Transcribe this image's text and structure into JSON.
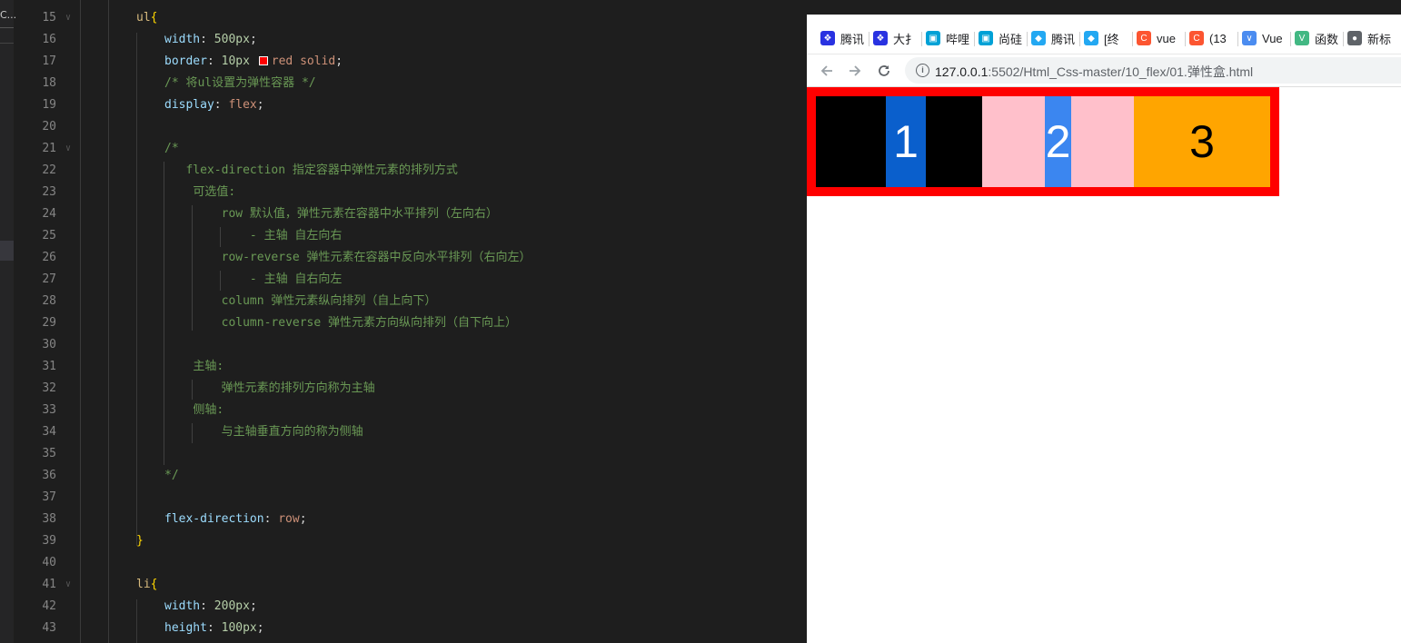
{
  "editor": {
    "left_strip_label": "C...",
    "lines": [
      {
        "n": "15",
        "fold": true,
        "indent": 1,
        "tokens": [
          {
            "c": "t-sel",
            "t": "ul"
          },
          {
            "c": "t-brace",
            "t": "{"
          }
        ]
      },
      {
        "n": "16",
        "indent": 2,
        "tokens": [
          {
            "c": "t-prop",
            "t": "width"
          },
          {
            "c": "t-punc",
            "t": ": "
          },
          {
            "c": "t-num",
            "t": "500px"
          },
          {
            "c": "t-punc",
            "t": ";"
          }
        ]
      },
      {
        "n": "17",
        "indent": 2,
        "tokens": [
          {
            "c": "t-prop",
            "t": "border"
          },
          {
            "c": "t-punc",
            "t": ": "
          },
          {
            "c": "t-num",
            "t": "10px "
          },
          {
            "c": "t-swatch",
            "t": ""
          },
          {
            "c": "t-val",
            "t": "red solid"
          },
          {
            "c": "t-punc",
            "t": ";"
          }
        ]
      },
      {
        "n": "18",
        "indent": 2,
        "tokens": [
          {
            "c": "t-com",
            "t": "/* 将ul设置为弹性容器 */"
          }
        ]
      },
      {
        "n": "19",
        "indent": 2,
        "tokens": [
          {
            "c": "t-prop",
            "t": "display"
          },
          {
            "c": "t-punc",
            "t": ": "
          },
          {
            "c": "t-val",
            "t": "flex"
          },
          {
            "c": "t-punc",
            "t": ";"
          }
        ]
      },
      {
        "n": "20",
        "indent": 0,
        "tokens": []
      },
      {
        "n": "21",
        "fold": true,
        "indent": 2,
        "tokens": [
          {
            "c": "t-com",
            "t": "/*"
          }
        ]
      },
      {
        "n": "22",
        "indent": 2,
        "pad": "   ",
        "tokens": [
          {
            "c": "t-com",
            "t": "flex-direction 指定容器中弹性元素的排列方式"
          }
        ]
      },
      {
        "n": "23",
        "indent": 2,
        "pad": "    ",
        "tokens": [
          {
            "c": "t-com",
            "t": "可选值:"
          }
        ]
      },
      {
        "n": "24",
        "indent": 2,
        "pad": "        ",
        "tokens": [
          {
            "c": "t-com",
            "t": "row 默认值，弹性元素在容器中水平排列（左向右）"
          }
        ]
      },
      {
        "n": "25",
        "indent": 2,
        "pad": "            ",
        "tokens": [
          {
            "c": "t-com",
            "t": "- 主轴 自左向右"
          }
        ]
      },
      {
        "n": "26",
        "indent": 2,
        "pad": "        ",
        "tokens": [
          {
            "c": "t-com",
            "t": "row-reverse 弹性元素在容器中反向水平排列（右向左）"
          }
        ]
      },
      {
        "n": "27",
        "indent": 2,
        "pad": "            ",
        "tokens": [
          {
            "c": "t-com",
            "t": "- 主轴 自右向左"
          }
        ]
      },
      {
        "n": "28",
        "indent": 2,
        "pad": "        ",
        "tokens": [
          {
            "c": "t-com",
            "t": "column 弹性元素纵向排列（自上向下）"
          }
        ]
      },
      {
        "n": "29",
        "indent": 2,
        "pad": "        ",
        "tokens": [
          {
            "c": "t-com",
            "t": "column-reverse 弹性元素方向纵向排列（自下向上）"
          }
        ]
      },
      {
        "n": "30",
        "indent": 0,
        "tokens": []
      },
      {
        "n": "31",
        "indent": 2,
        "pad": "    ",
        "tokens": [
          {
            "c": "t-com",
            "t": "主轴:"
          }
        ]
      },
      {
        "n": "32",
        "indent": 2,
        "pad": "        ",
        "tokens": [
          {
            "c": "t-com",
            "t": "弹性元素的排列方向称为主轴"
          }
        ]
      },
      {
        "n": "33",
        "indent": 2,
        "pad": "    ",
        "tokens": [
          {
            "c": "t-com",
            "t": "侧轴:"
          }
        ]
      },
      {
        "n": "34",
        "indent": 2,
        "pad": "        ",
        "tokens": [
          {
            "c": "t-com",
            "t": "与主轴垂直方向的称为侧轴"
          }
        ]
      },
      {
        "n": "35",
        "indent": 0,
        "tokens": []
      },
      {
        "n": "36",
        "indent": 2,
        "tokens": [
          {
            "c": "t-com",
            "t": "*/"
          }
        ]
      },
      {
        "n": "37",
        "indent": 0,
        "tokens": []
      },
      {
        "n": "38",
        "indent": 2,
        "tokens": [
          {
            "c": "t-prop",
            "t": "flex-direction"
          },
          {
            "c": "t-punc",
            "t": ": "
          },
          {
            "c": "t-val",
            "t": "row"
          },
          {
            "c": "t-punc",
            "t": ";"
          }
        ]
      },
      {
        "n": "39",
        "indent": 1,
        "tokens": [
          {
            "c": "t-brace",
            "t": "}"
          }
        ]
      },
      {
        "n": "40",
        "indent": 0,
        "tokens": []
      },
      {
        "n": "41",
        "fold": true,
        "indent": 1,
        "tokens": [
          {
            "c": "t-sel",
            "t": "li"
          },
          {
            "c": "t-brace",
            "t": "{"
          }
        ]
      },
      {
        "n": "42",
        "indent": 2,
        "tokens": [
          {
            "c": "t-prop",
            "t": "width"
          },
          {
            "c": "t-punc",
            "t": ": "
          },
          {
            "c": "t-num",
            "t": "200px"
          },
          {
            "c": "t-punc",
            "t": ";"
          }
        ]
      },
      {
        "n": "43",
        "indent": 2,
        "tokens": [
          {
            "c": "t-prop",
            "t": "height"
          },
          {
            "c": "t-punc",
            "t": ": "
          },
          {
            "c": "t-num",
            "t": "100px"
          },
          {
            "c": "t-punc",
            "t": ";"
          }
        ]
      }
    ]
  },
  "browser": {
    "bookmarks": [
      {
        "label": "腾讯",
        "icon": "paw-icon",
        "color": "#2932e1"
      },
      {
        "label": "大扌",
        "icon": "paw-icon",
        "color": "#2932e1"
      },
      {
        "label": "哔哩",
        "icon": "bilibili-icon",
        "color": "#00a1d6"
      },
      {
        "label": "尚硅",
        "icon": "bilibili-icon",
        "color": "#00a1d6"
      },
      {
        "label": "腾讯",
        "icon": "diamond-icon",
        "color": "#23a8f2"
      },
      {
        "label": "[终",
        "icon": "diamond-icon",
        "color": "#23a8f2"
      },
      {
        "label": "vue",
        "icon": "csdn-icon",
        "color": "#fc5531"
      },
      {
        "label": "(13",
        "icon": "csdn-icon",
        "color": "#fc5531"
      },
      {
        "label": "Vue",
        "icon": "chevron-icon",
        "color": "#4b8cf0"
      },
      {
        "label": "函数",
        "icon": "vue-icon",
        "color": "#42b883"
      },
      {
        "label": "新标",
        "icon": "globe-icon",
        "color": "#5f6368"
      }
    ],
    "url_host": "127.0.0.1",
    "url_path": ":5502/Html_Css-master/10_flex/01.弹性盒.html",
    "items": [
      {
        "label": "1",
        "bg": "#000000",
        "sel": "#0a5fcc",
        "color": "#ffffff"
      },
      {
        "label": "2",
        "bg": "#ffc0cb",
        "sel": "#3b86f0",
        "color": "#ffffff"
      },
      {
        "label": "3",
        "bg": "#ffa500",
        "sel": "",
        "color": "#000000"
      }
    ]
  }
}
